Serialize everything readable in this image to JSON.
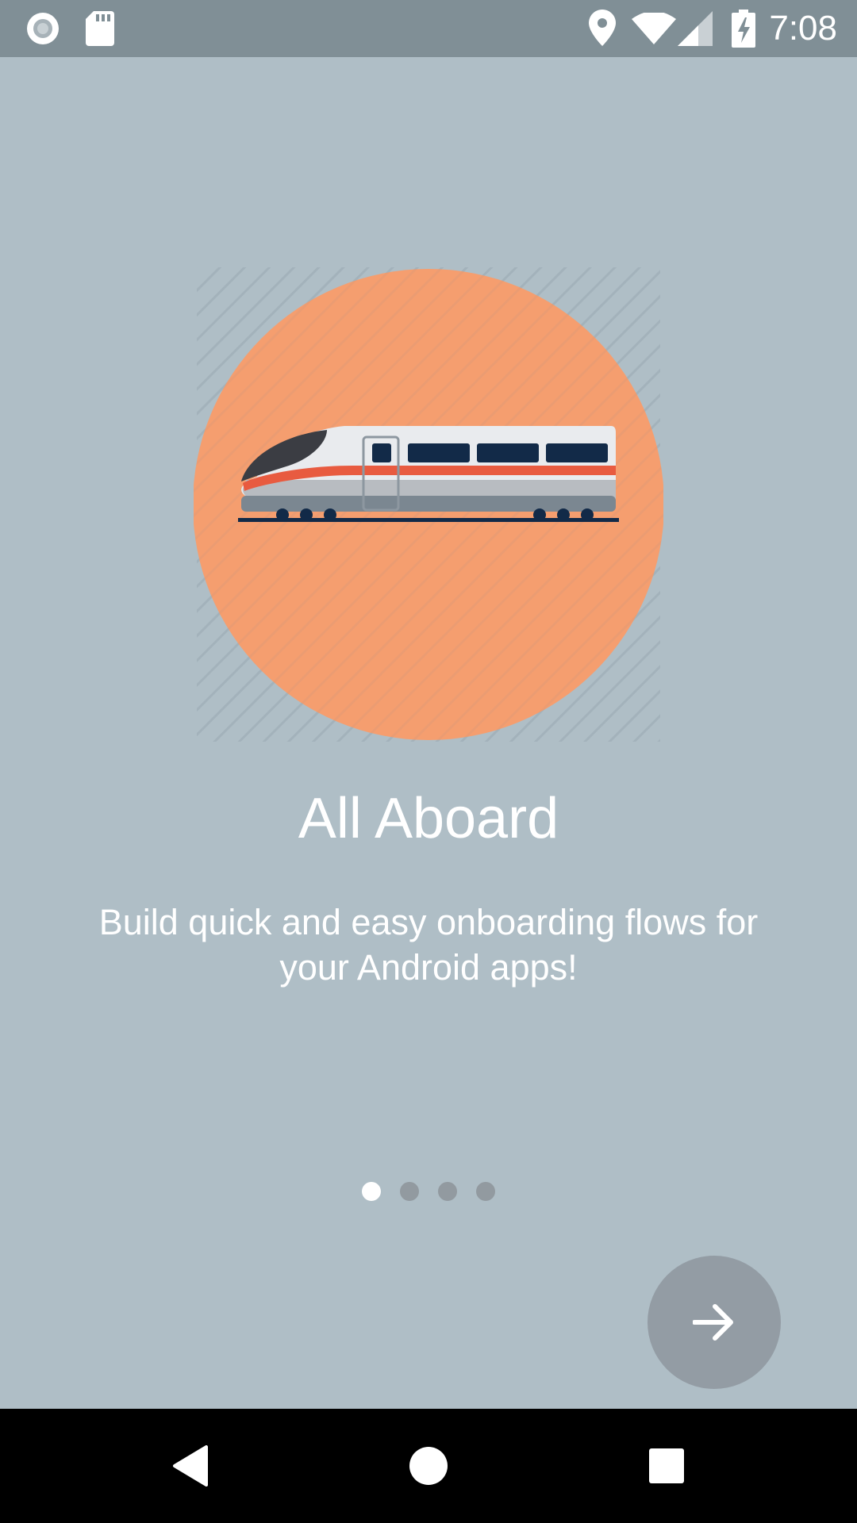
{
  "status_bar": {
    "time": "7:08",
    "icons": [
      "record-icon",
      "sd-card-icon",
      "location-icon",
      "wifi-icon",
      "cell-signal-icon",
      "battery-charging-icon"
    ]
  },
  "onboarding": {
    "illustration": "high-speed-train-illustration",
    "title": "All Aboard",
    "description": "Build quick and easy onboarding flows for your Android apps!",
    "page_indicator": {
      "total": 4,
      "current": 1
    },
    "next_icon": "arrow-right-icon"
  },
  "colors": {
    "background": "#afbec6",
    "status_bar": "#808f96",
    "circle": "#f59e6f",
    "accent_red": "#e85b40",
    "window_navy": "#122a48",
    "fab": "#939ca4"
  },
  "nav_bar": {
    "icons": [
      "back-icon",
      "home-icon",
      "recents-icon"
    ]
  }
}
